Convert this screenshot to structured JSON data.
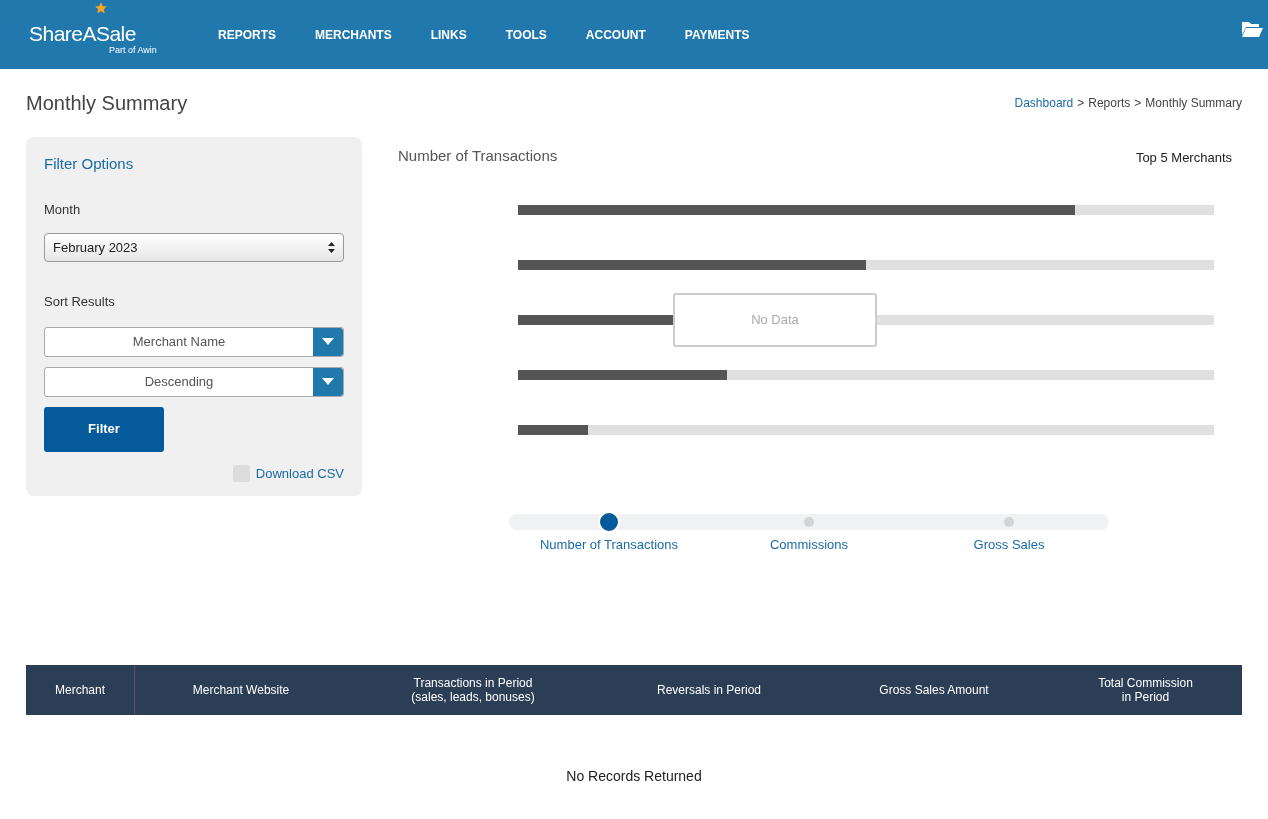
{
  "header": {
    "logo": "ShareASale",
    "logo_subtitle": "Part of Awin",
    "nav": [
      "REPORTS",
      "MERCHANTS",
      "LINKS",
      "TOOLS",
      "ACCOUNT",
      "PAYMENTS"
    ]
  },
  "page": {
    "title": "Monthly Summary",
    "breadcrumb": [
      {
        "label": "Dashboard",
        "link": true
      },
      {
        "label": ">",
        "link": false
      },
      {
        "label": "Reports",
        "link": false
      },
      {
        "label": ">",
        "link": false
      },
      {
        "label": "Monthly Summary",
        "link": false
      }
    ]
  },
  "filter": {
    "title": "Filter Options",
    "month_label": "Month",
    "month_value": "February 2023",
    "sort_label": "Sort Results",
    "sort_by": "Merchant Name",
    "sort_order": "Descending",
    "button": "Filter",
    "download": {
      "label": "Download CSV",
      "checked": false
    }
  },
  "chart": {
    "title": "Number of Transactions",
    "subtitle": "Top 5 Merchants",
    "overlay": "No Data"
  },
  "metric_slider": [
    {
      "label": "Number of Transactions",
      "selected": true
    },
    {
      "label": "Commissions",
      "selected": false
    },
    {
      "label": "Gross Sales",
      "selected": false
    }
  ],
  "table": {
    "columns": [
      "Merchant",
      "Merchant Website",
      "Transactions in Period\n(sales, leads, bonuses)",
      "Reversals in Period",
      "Gross Sales Amount",
      "Total Commission\nin Period"
    ],
    "empty_message": "No Records Returned"
  }
}
